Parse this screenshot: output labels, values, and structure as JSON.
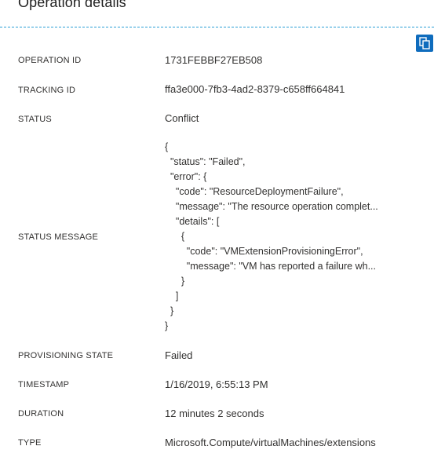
{
  "panel": {
    "title": "Operation details",
    "copy_icon": "copy-icon"
  },
  "fields": {
    "operation_id": {
      "label": "OPERATION ID",
      "value": "1731FEBBF27EB508"
    },
    "tracking_id": {
      "label": "TRACKING ID",
      "value": "ffa3e000-7fb3-4ad2-8379-c658ff664841"
    },
    "status": {
      "label": "STATUS",
      "value": "Conflict"
    },
    "status_message": {
      "label": "STATUS MESSAGE",
      "lines": [
        "{",
        "  \"status\": \"Failed\",",
        "  \"error\": {",
        "    \"code\": \"ResourceDeploymentFailure\",",
        "    \"message\": \"The resource operation complet...",
        "    \"details\": [",
        "      {",
        "        \"code\": \"VMExtensionProvisioningError\",",
        "        \"message\": \"VM has reported a failure wh...",
        "      }",
        "    ]",
        "  }",
        "}"
      ]
    },
    "provisioning_state": {
      "label": "PROVISIONING STATE",
      "value": "Failed"
    },
    "timestamp": {
      "label": "TIMESTAMP",
      "value": "1/16/2019, 6:55:13 PM"
    },
    "duration": {
      "label": "DURATION",
      "value": "12 minutes 2 seconds"
    },
    "type": {
      "label": "TYPE",
      "value": "Microsoft.Compute/virtualMachines/extensions"
    }
  }
}
